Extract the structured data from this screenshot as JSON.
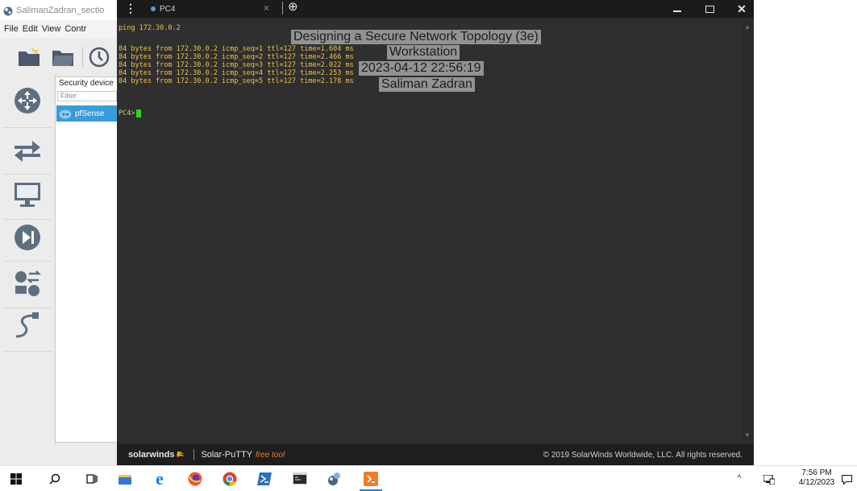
{
  "gns3": {
    "title": "SalimanZadran_sectio",
    "menu": [
      "File",
      "Edit",
      "View",
      "Contr"
    ],
    "device_panel_title": "Security device",
    "filter_placeholder": "Filter",
    "device_item": "pfSense"
  },
  "putty": {
    "tab_label": "PC4",
    "terminal_lines": [
      "ping 172.30.0.2",
      "",
      "84 bytes from 172.30.0.2 icmp_seq=1 ttl=127 time=1.604 ms",
      "84 bytes from 172.30.0.2 icmp_seq=2 ttl=127 time=2.466 ms",
      "84 bytes from 172.30.0.2 icmp_seq=3 ttl=127 time=2.022 ms",
      "84 bytes from 172.30.0.2 icmp_seq=4 ttl=127 time=2.253 ms",
      "84 bytes from 172.30.0.2 icmp_seq=5 ttl=127 time=2.178 ms",
      "",
      "PC4>"
    ],
    "footer_logo": "solarwinds",
    "footer_app": "Solar-PuTTY",
    "footer_free": "free tool",
    "footer_copyright": "© 2019 SolarWinds Worldwide, LLC. All rights reserved."
  },
  "overlay": {
    "line1": "Designing a Secure Network Topology (3e)",
    "line2": "Workstation",
    "line3": "2023-04-12 22:56:19",
    "line4": "Saliman Zadran"
  },
  "taskbar": {
    "time": "7:56 PM",
    "date": "4/12/2023"
  },
  "colors": {
    "terminal_text": "#f0c046",
    "cursor": "#22d822",
    "accent_blue": "#3a9bd9"
  }
}
